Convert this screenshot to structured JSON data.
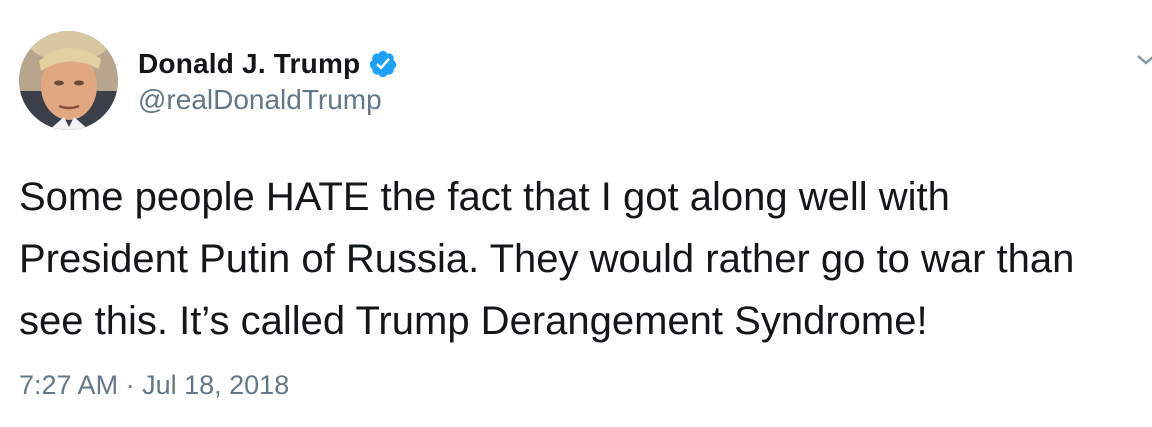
{
  "user": {
    "display_name": "Donald J. Trump",
    "handle": "@realDonaldTrump",
    "verified": true,
    "verified_icon": "verified-badge-icon",
    "verified_color": "#1da1f2"
  },
  "tweet": {
    "lines": [
      "Some people HATE the fact that I got along well with",
      "President Putin of Russia. They would rather go to war than",
      "see this. It’s called Trump Derangement Syndrome!"
    ]
  },
  "meta": {
    "time": "7:27 AM",
    "separator": "·",
    "date": "Jul 18, 2018"
  },
  "colors": {
    "text": "#14171a",
    "secondary": "#657786",
    "accent": "#1da1f2"
  }
}
